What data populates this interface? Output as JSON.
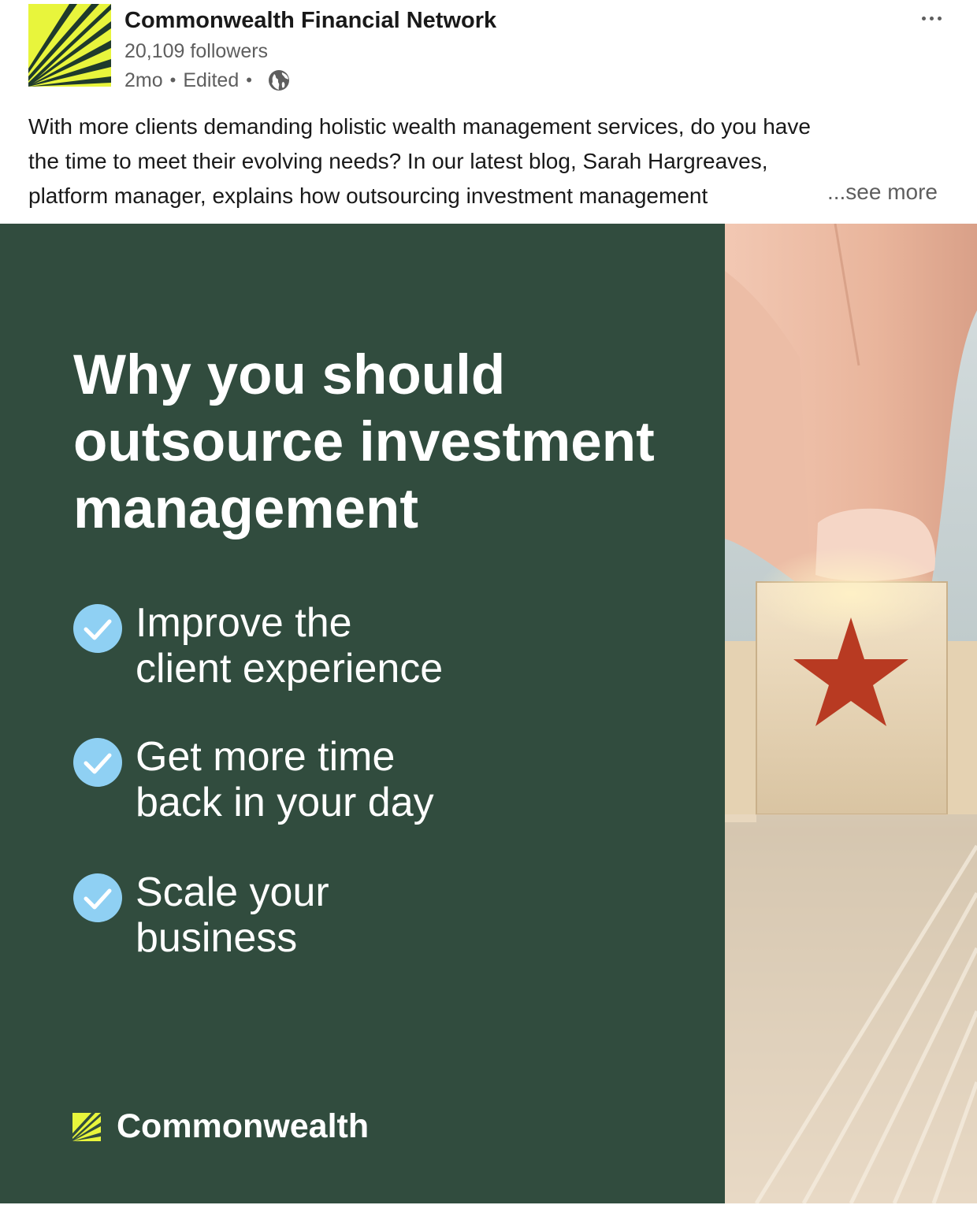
{
  "post": {
    "author_name": "Commonwealth Financial Network",
    "followers": "20,109 followers",
    "age": "2mo",
    "dot": "•",
    "edited": "Edited",
    "more_icon": "more-options-icon",
    "visibility_icon": "globe-icon",
    "text_lines": [
      "With more clients demanding holistic wealth management services, do you have",
      "the time to meet their evolving needs? In our latest blog, Sarah Hargreaves,",
      "platform manager, explains how outsourcing investment management"
    ],
    "see_more": "...see more"
  },
  "media": {
    "headline_lines": [
      "Why you should",
      "outsource investment",
      "management"
    ],
    "benefits": [
      {
        "line1": "Improve the",
        "line2": "client experience",
        "icon": "checkmark-icon"
      },
      {
        "line1": "Get more time",
        "line2": "back in your day",
        "icon": "checkmark-icon"
      },
      {
        "line1": "Scale your",
        "line2": "business",
        "icon": "checkmark-icon"
      }
    ],
    "brand_name": "Commonwealth",
    "colors": {
      "panel_green": "#314c3e",
      "check_blue": "#8fd0f3",
      "logo_yellow": "#e8f53c",
      "star_red": "#b83a22"
    }
  }
}
